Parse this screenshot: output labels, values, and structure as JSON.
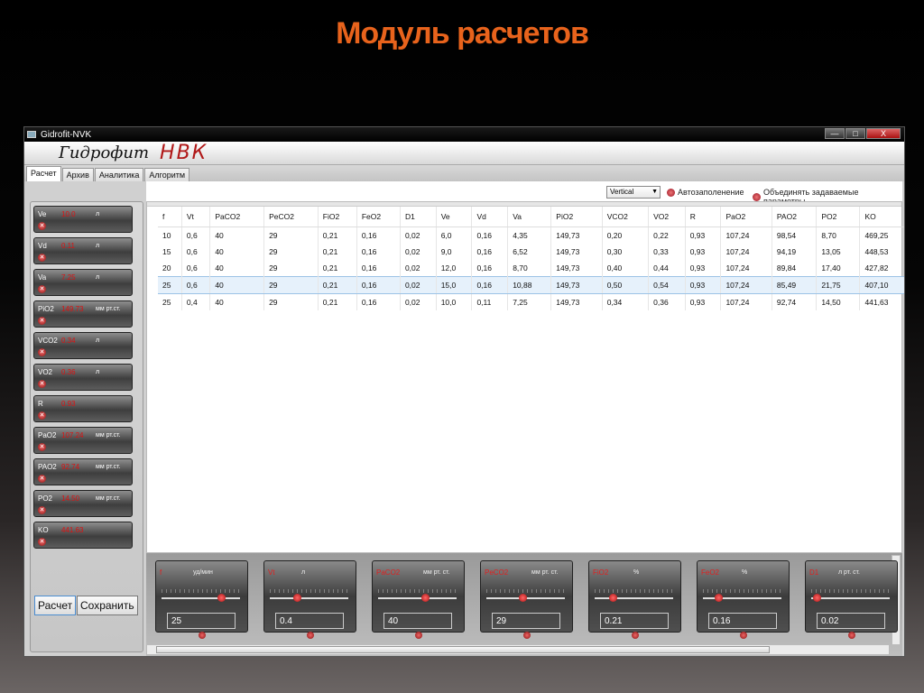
{
  "slide_title": "Модуль расчетов",
  "window": {
    "title": "Gidrofit-NVK",
    "controls": {
      "minimize": "—",
      "maximize": "□",
      "close": "X"
    }
  },
  "logo": {
    "brand": "Гидрофит",
    "product": "НВК"
  },
  "tabs": [
    "Расчет",
    "Архив",
    "Аналитика",
    "Алгоритм"
  ],
  "active_tab": "Расчет",
  "toolbar": {
    "orientation": "Vertical",
    "autofill": "Автозаполенение",
    "merge": "Объединять задаваемые параметры"
  },
  "left_params": [
    {
      "name": "Ve",
      "value": "10.0",
      "unit": "л"
    },
    {
      "name": "Vd",
      "value": "0.11",
      "unit": "л"
    },
    {
      "name": "Va",
      "value": "7.25",
      "unit": "л"
    },
    {
      "name": "PiO2",
      "value": "149.73",
      "unit": "мм рт.ст."
    },
    {
      "name": "VCO2",
      "value": "0.34",
      "unit": "л"
    },
    {
      "name": "VO2",
      "value": "0.36",
      "unit": "л"
    },
    {
      "name": "R",
      "value": "0.93",
      "unit": ""
    },
    {
      "name": "PaO2",
      "value": "107.24",
      "unit": "мм рт.ст."
    },
    {
      "name": "PAO2",
      "value": "92.74",
      "unit": "мм рт.ст."
    },
    {
      "name": "PO2",
      "value": "14.50",
      "unit": "мм рт.ст."
    },
    {
      "name": "KO",
      "value": "441.63",
      "unit": ""
    }
  ],
  "buttons": {
    "calc": "Расчет",
    "save": "Сохранить"
  },
  "table": {
    "headers": [
      "f",
      "Vt",
      "PaCO2",
      "PeCO2",
      "FiO2",
      "FeO2",
      "D1",
      "Ve",
      "Vd",
      "Va",
      "PiO2",
      "VCO2",
      "VO2",
      "R",
      "PaO2",
      "PAO2",
      "PO2",
      "KO"
    ],
    "rows": [
      [
        "10",
        "0,6",
        "40",
        "29",
        "0,21",
        "0,16",
        "0,02",
        "6,0",
        "0,16",
        "4,35",
        "149,73",
        "0,20",
        "0,22",
        "0,93",
        "107,24",
        "98,54",
        "8,70",
        "469,25"
      ],
      [
        "15",
        "0,6",
        "40",
        "29",
        "0,21",
        "0,16",
        "0,02",
        "9,0",
        "0,16",
        "6,52",
        "149,73",
        "0,30",
        "0,33",
        "0,93",
        "107,24",
        "94,19",
        "13,05",
        "448,53"
      ],
      [
        "20",
        "0,6",
        "40",
        "29",
        "0,21",
        "0,16",
        "0,02",
        "12,0",
        "0,16",
        "8,70",
        "149,73",
        "0,40",
        "0,44",
        "0,93",
        "107,24",
        "89,84",
        "17,40",
        "427,82"
      ],
      [
        "25",
        "0,6",
        "40",
        "29",
        "0,21",
        "0,16",
        "0,02",
        "15,0",
        "0,16",
        "10,88",
        "149,73",
        "0,50",
        "0,54",
        "0,93",
        "107,24",
        "85,49",
        "21,75",
        "407,10"
      ],
      [
        "25",
        "0,4",
        "40",
        "29",
        "0,21",
        "0,16",
        "0,02",
        "10,0",
        "0,11",
        "7,25",
        "149,73",
        "0,34",
        "0,36",
        "0,93",
        "107,24",
        "92,74",
        "14,50",
        "441,63"
      ]
    ],
    "highlighted_row": 3
  },
  "sliders": [
    {
      "name": "f",
      "unit": "уд/мин",
      "value": "25",
      "level": 0.78
    },
    {
      "name": "Vt",
      "unit": "л",
      "value": "0.4",
      "level": 0.32
    },
    {
      "name": "PaCO2",
      "unit": "мм рт. ст.",
      "value": "40",
      "level": 0.6
    },
    {
      "name": "PeCO2",
      "unit": "мм рт. ст.",
      "value": "29",
      "level": 0.45
    },
    {
      "name": "FiO2",
      "unit": "%",
      "value": "0.21",
      "level": 0.2
    },
    {
      "name": "FeO2",
      "unit": "%",
      "value": "0.16",
      "level": 0.16
    },
    {
      "name": "D1",
      "unit": "л рт. ст.",
      "value": "0.02",
      "level": 0.02
    }
  ]
}
